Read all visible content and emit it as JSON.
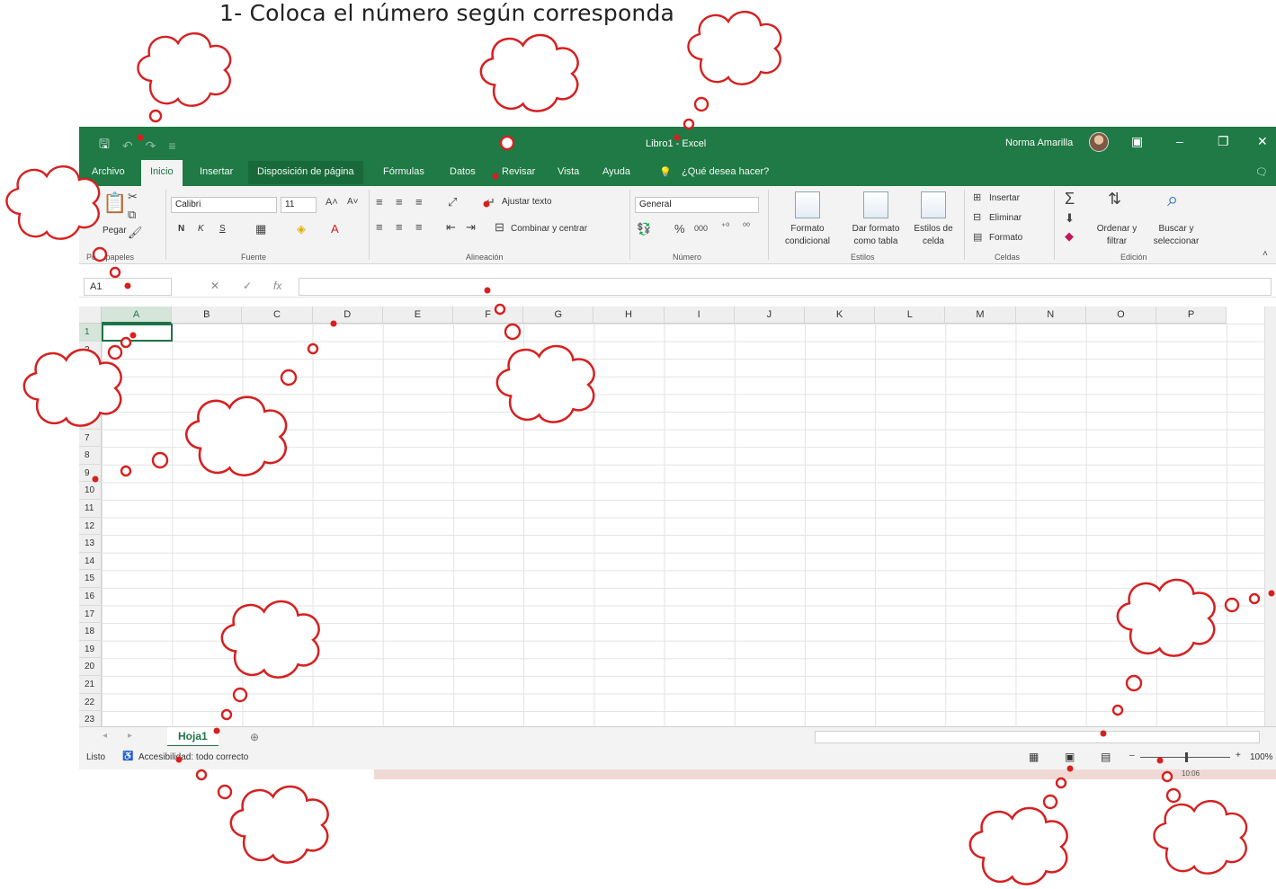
{
  "instruction": "1- Coloca el número según corresponda",
  "window": {
    "title": "Libro1 - Excel",
    "user_name": "Norma Amarilla"
  },
  "tabs": [
    "Archivo",
    "Inicio",
    "Insertar",
    "Disposición de página",
    "Fórmulas",
    "Datos",
    "Revisar",
    "Vista",
    "Ayuda"
  ],
  "tell_me": "¿Qué desea hacer?",
  "ribbon": {
    "clipboard": {
      "paste_label": "Pegar",
      "label": "Portapapeles"
    },
    "font": {
      "name": "Calibri",
      "size": "11",
      "bold": "N",
      "italic": "K",
      "underline": "S",
      "label": "Fuente"
    },
    "alignment": {
      "wrap": "Ajustar texto",
      "merge": "Combinar y centrar",
      "label": "Alineación"
    },
    "number": {
      "format": "General",
      "label": "Número"
    },
    "styles": {
      "conditional_1": "Formato",
      "conditional_2": "condicional",
      "table_1": "Dar formato",
      "table_2": "como tabla",
      "cell_1": "Estilos de",
      "cell_2": "celda",
      "label": "Estilos"
    },
    "cells": {
      "insert": "Insertar",
      "delete": "Eliminar",
      "format": "Formato",
      "label": "Celdas"
    },
    "editing": {
      "sort_1": "Ordenar y",
      "sort_2": "filtrar",
      "find_1": "Buscar y",
      "find_2": "seleccionar",
      "label": "Edición"
    }
  },
  "formula_bar": {
    "name_box": "A1",
    "fx": "fx"
  },
  "columns": [
    "A",
    "B",
    "C",
    "D",
    "E",
    "F",
    "G",
    "H",
    "I",
    "J",
    "K",
    "L",
    "M",
    "N",
    "O",
    "P"
  ],
  "rows": [
    "1",
    "2",
    "3",
    "4",
    "5",
    "6",
    "7",
    "8",
    "9",
    "10",
    "11",
    "12",
    "13",
    "14",
    "15",
    "16",
    "17",
    "18",
    "19",
    "20",
    "21",
    "22",
    "23"
  ],
  "sheet": {
    "tab": "Hoja1"
  },
  "status": {
    "ready": "Listo",
    "accessibility": "Accesibilidad: todo correcto",
    "zoom": "100%",
    "clock": "10:06"
  },
  "colors": {
    "excel_green": "#1f7a45",
    "accent_dark": "#217346",
    "callout_red": "#d62020"
  }
}
